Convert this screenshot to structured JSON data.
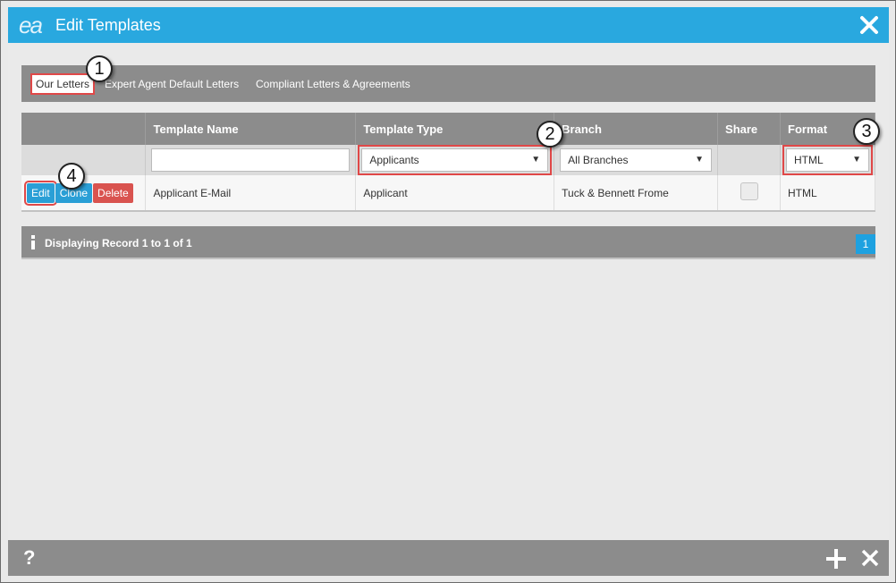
{
  "window": {
    "logo": "ea",
    "title": "Edit Templates"
  },
  "tabs": [
    {
      "label": "Our Letters",
      "active": true
    },
    {
      "label": "Expert Agent Default Letters",
      "active": false
    },
    {
      "label": "Compliant Letters & Agreements",
      "active": false
    }
  ],
  "table": {
    "columns": [
      "",
      "Template Name",
      "Template Type",
      "Branch",
      "Share",
      "Format"
    ],
    "filters": {
      "template_name": "",
      "template_type": "Applicants",
      "branch": "All Branches",
      "format": "HTML"
    },
    "rows": [
      {
        "actions": {
          "edit": "Edit",
          "clone": "Clone",
          "delete": "Delete"
        },
        "template_name": "Applicant E-Mail",
        "template_type": "Applicant",
        "branch": "Tuck & Bennett Frome",
        "share": false,
        "format": "HTML"
      }
    ]
  },
  "pager": {
    "info": "Displaying Record 1 to 1 of 1",
    "page": "1"
  },
  "bottom": {
    "help": "?"
  },
  "callouts": [
    "1",
    "2",
    "3",
    "4"
  ],
  "colors": {
    "title_bar": "#29a8df",
    "highlight": "#e04848",
    "edit": "#2a9fd6",
    "delete": "#d9534f",
    "bar_gray": "#8c8c8c"
  }
}
